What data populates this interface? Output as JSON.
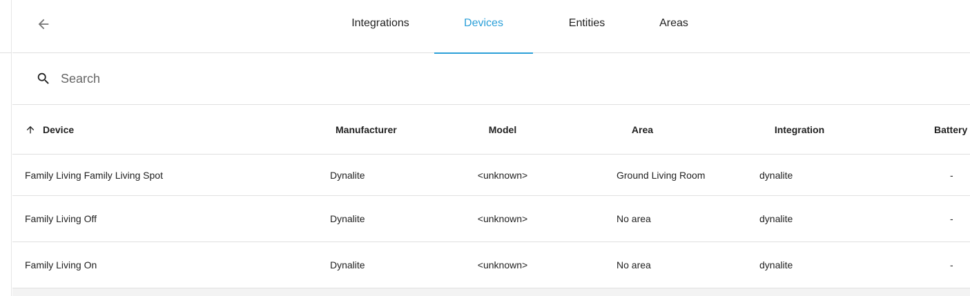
{
  "toolbar": {
    "tabs": [
      {
        "label": "Integrations",
        "active": false
      },
      {
        "label": "Devices",
        "active": true
      },
      {
        "label": "Entities",
        "active": false
      },
      {
        "label": "Areas",
        "active": false
      }
    ]
  },
  "search": {
    "placeholder": "Search",
    "value": ""
  },
  "table": {
    "columns": [
      "Device",
      "Manufacturer",
      "Model",
      "Area",
      "Integration",
      "Battery"
    ],
    "sort_column": "Device",
    "sort_direction": "ascending",
    "rows": [
      {
        "device": "Family Living Family Living Spot",
        "manufacturer": "Dynalite",
        "model": "<unknown>",
        "area": "Ground Living Room",
        "integration": "dynalite",
        "battery": "-"
      },
      {
        "device": "Family Living Off",
        "manufacturer": "Dynalite",
        "model": "<unknown>",
        "area": "No area",
        "integration": "dynalite",
        "battery": "-"
      },
      {
        "device": "Family Living On",
        "manufacturer": "Dynalite",
        "model": "<unknown>",
        "area": "No area",
        "integration": "dynalite",
        "battery": "-"
      }
    ]
  },
  "colors": {
    "accent": "#2a9fd8",
    "text": "#212121",
    "divider": "#e0e0e0"
  },
  "icons": {
    "back": "arrow-left-icon",
    "search": "magnify-icon",
    "sort": "arrow-up-icon"
  }
}
